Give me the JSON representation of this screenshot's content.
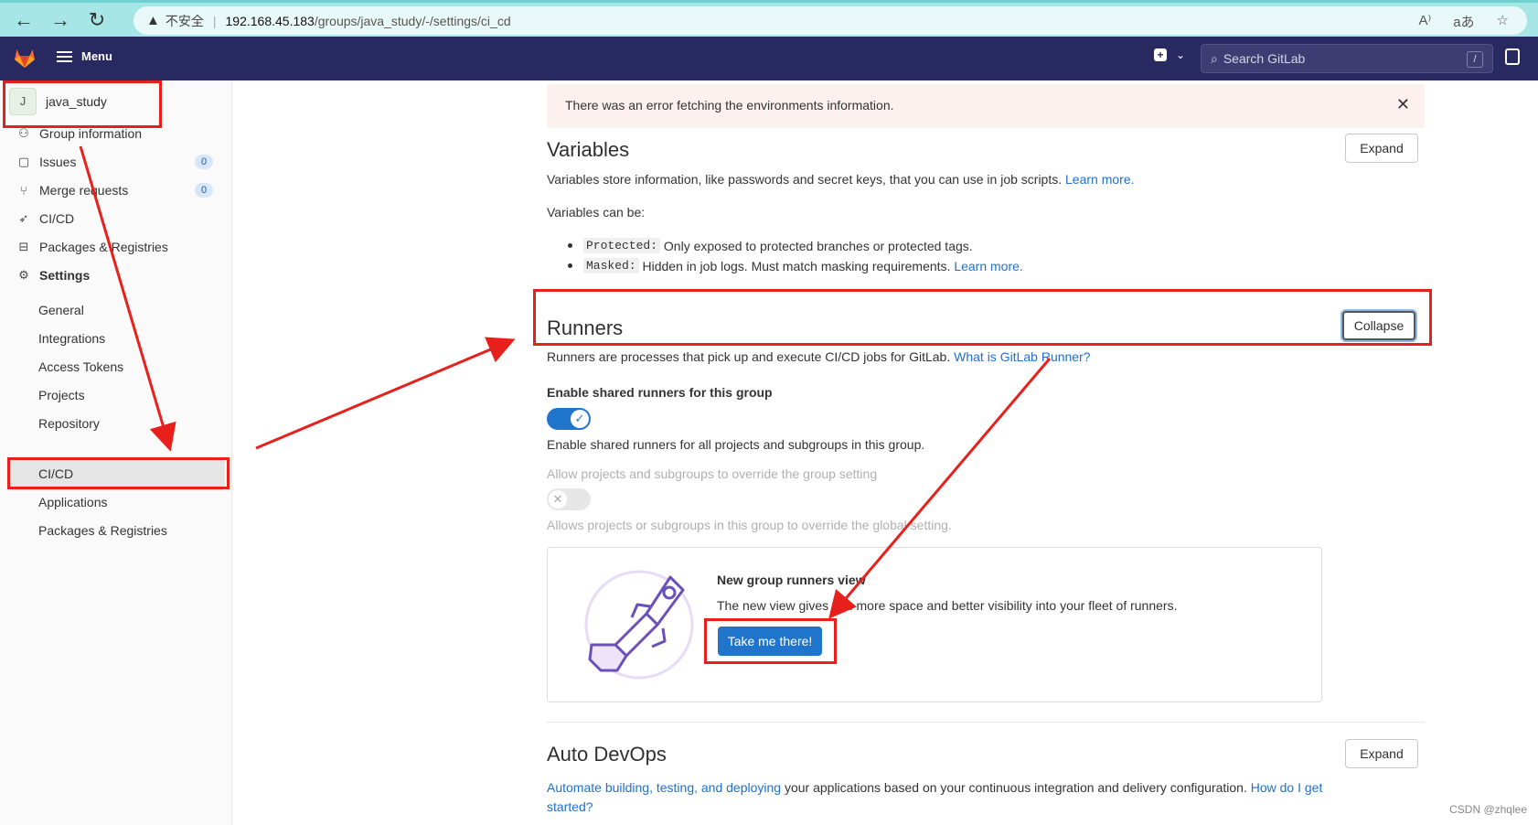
{
  "browser": {
    "security_label": "不安全",
    "url_host": "192.168.45.183",
    "url_path": "/groups/java_study/-/settings/ci_cd"
  },
  "header": {
    "menu_label": "Menu",
    "search_placeholder": "Search GitLab",
    "search_shortcut": "/"
  },
  "sidebar": {
    "group_avatar": "J",
    "group_name": "java_study",
    "items": [
      {
        "label": "Group information",
        "icon": "group-icon"
      },
      {
        "label": "Issues",
        "icon": "issues-icon",
        "count": "0"
      },
      {
        "label": "Merge requests",
        "icon": "merge-request-icon",
        "count": "0"
      },
      {
        "label": "CI/CD",
        "icon": "rocket-icon"
      },
      {
        "label": "Packages & Registries",
        "icon": "package-icon"
      },
      {
        "label": "Settings",
        "icon": "gear-icon"
      }
    ],
    "settings_sub": [
      "General",
      "Integrations",
      "Access Tokens",
      "Projects",
      "Repository",
      "CI/CD",
      "Applications",
      "Packages & Registries"
    ]
  },
  "alert": {
    "text": "There was an error fetching the environments information."
  },
  "variables": {
    "title": "Variables",
    "button": "Expand",
    "description": "Variables store information, like passwords and secret keys, that you can use in job scripts.",
    "learn_more": "Learn more.",
    "can_be": "Variables can be:",
    "protected_code": "Protected:",
    "protected_text": "Only exposed to protected branches or protected tags.",
    "masked_code": "Masked:",
    "masked_text": "Hidden in job logs. Must match masking requirements.",
    "masked_learn": "Learn more."
  },
  "runners": {
    "title": "Runners",
    "button": "Collapse",
    "description": "Runners are processes that pick up and execute CI/CD jobs for GitLab.",
    "what_is": "What is GitLab Runner?",
    "shared_label": "Enable shared runners for this group",
    "shared_enabled": true,
    "shared_help": "Enable shared runners for all projects and subgroups in this group.",
    "override_label": "Allow projects and subgroups to override the group setting",
    "override_enabled": false,
    "override_help": "Allows projects or subgroups in this group to override the global setting.",
    "card_title": "New group runners view",
    "card_text": "The new view gives you more space and better visibility into your fleet of runners.",
    "card_button": "Take me there!"
  },
  "autodevops": {
    "title": "Auto DevOps",
    "button": "Expand",
    "link1": "Automate building, testing, and deploying",
    "text": "your applications based on your continuous integration and delivery configuration.",
    "link2a": "How do I",
    "link2b": "get started?"
  },
  "watermark": "CSDN @zhqlee",
  "colors": {
    "header": "#292961",
    "accent": "#1f75cb",
    "annotation": "#e8201c"
  }
}
